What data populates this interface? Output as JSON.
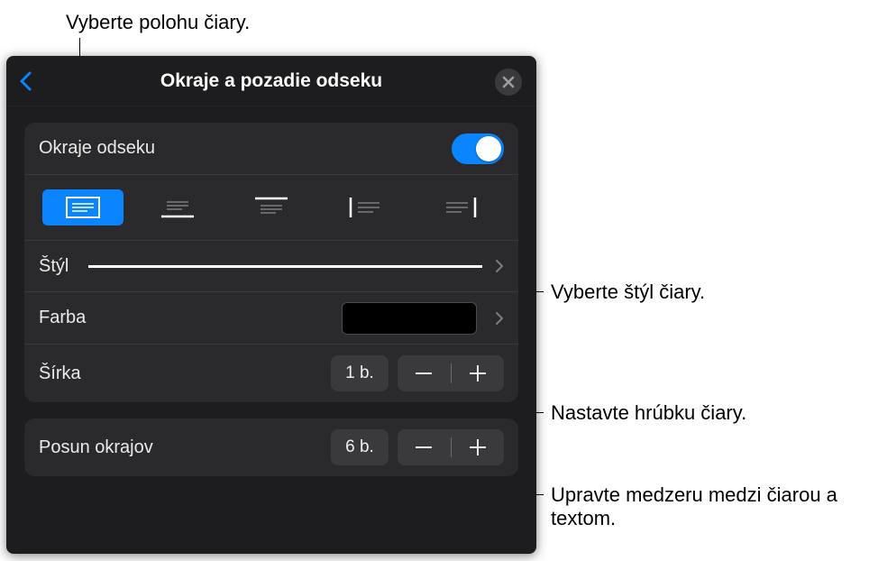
{
  "annotations": {
    "top": "Vyberte polohu čiary.",
    "style": "Vyberte štýl čiary.",
    "width": "Nastavte hrúbku čiary.",
    "offset": "Upravte medzeru medzi čiarou a textom."
  },
  "panel": {
    "title": "Okraje a pozadie odseku"
  },
  "borders": {
    "label": "Okraje odseku",
    "enabled": true,
    "position_icons": [
      "border-all-icon",
      "border-bottom-icon",
      "border-top-icon",
      "border-left-icon",
      "border-right-icon"
    ],
    "selected_position": 0,
    "style": {
      "label": "Štýl"
    },
    "color": {
      "label": "Farba",
      "value": "#000000"
    },
    "width": {
      "label": "Šírka",
      "value": "1 b."
    },
    "offset": {
      "label": "Posun okrajov",
      "value": "6 b."
    }
  }
}
